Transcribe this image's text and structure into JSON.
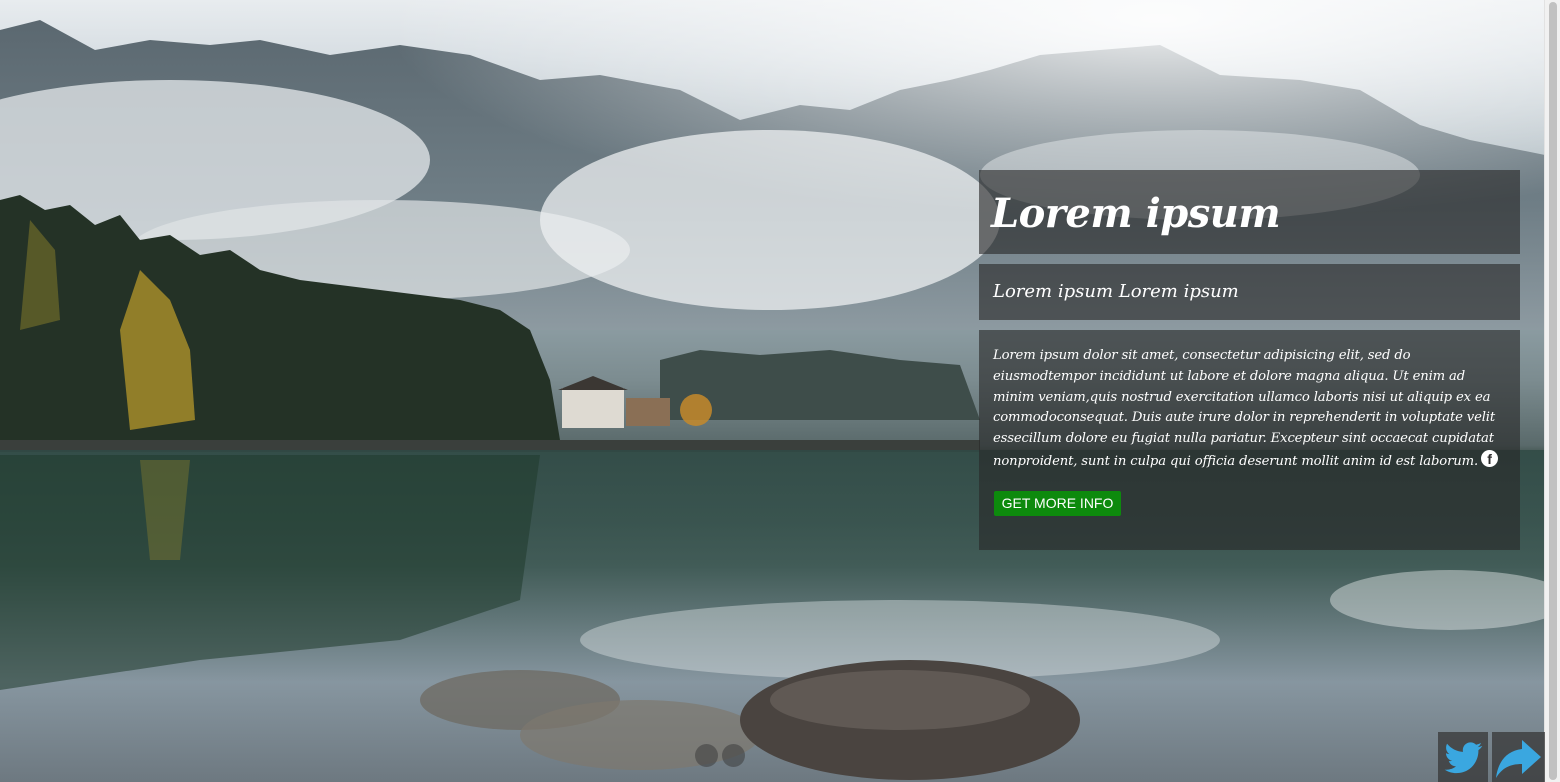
{
  "hero": {
    "title": "Lorem ipsum",
    "subtitle": "Lorem ipsum Lorem ipsum",
    "body": "Lorem ipsum dolor sit amet, consectetur adipisicing elit, sed do eiusmodtempor incididunt ut labore et dolore magna aliqua. Ut enim ad minim veniam,quis nostrud exercitation ullamco laboris nisi ut aliquip ex ea commodoconsequat. Duis aute irure dolor in reprehenderit in voluptate velit essecillum dolore eu fugiat nulla pariatur. Excepteur sint occaecat cupidatat nonproident, sunt in culpa qui officia deserunt mollit anim id est laborum.",
    "cta_label": "GET MORE INFO",
    "cta_color": "#0d8a0d"
  },
  "icons": {
    "facebook": "facebook-icon",
    "twitter": "twitter-icon",
    "share": "share-icon"
  },
  "slider": {
    "dot_count": 2
  },
  "colors": {
    "panel_bg": "rgba(40,40,40,0.62)",
    "text": "#ffffff",
    "social_icon": "#3aa7e0"
  }
}
